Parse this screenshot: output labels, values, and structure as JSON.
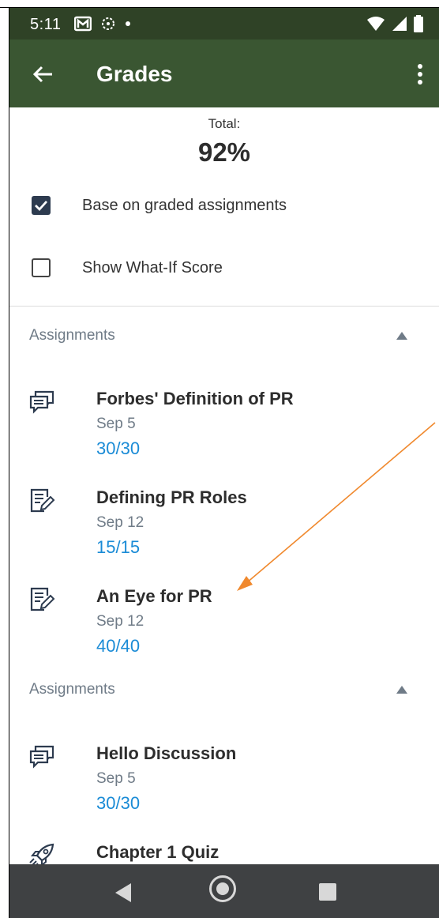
{
  "status_bar": {
    "time": "5:11",
    "icons_left": [
      "mail-icon",
      "app-icon",
      "dot-icon"
    ],
    "icons_right": [
      "wifi-icon",
      "signal-icon",
      "battery-icon"
    ]
  },
  "app_bar": {
    "title": "Grades",
    "back_icon": "arrow-left-icon",
    "menu_icon": "more-vert-icon"
  },
  "total": {
    "label": "Total:",
    "value": "92%"
  },
  "options": {
    "base_on_graded": {
      "label": "Base on graded assignments",
      "checked": true
    },
    "what_if": {
      "label": "Show What-If Score",
      "checked": false
    }
  },
  "sections": [
    {
      "header": "Assignments",
      "items": [
        {
          "title": "Forbes' Definition of PR",
          "date": "Sep 5",
          "score": "30/30",
          "icon": "discussion-icon"
        },
        {
          "title": "Defining PR Roles",
          "date": "Sep 12",
          "score": "15/15",
          "icon": "assignment-icon"
        },
        {
          "title": "An Eye for PR",
          "date": "Sep 12",
          "score": "40/40",
          "icon": "assignment-icon"
        }
      ]
    },
    {
      "header": "Assignments",
      "items": [
        {
          "title": "Hello Discussion",
          "date": "Sep 5",
          "score": "30/30",
          "icon": "discussion-icon"
        },
        {
          "title": "Chapter 1 Quiz",
          "date": "",
          "score": "",
          "icon": "quiz-rocket-icon"
        }
      ]
    }
  ],
  "colors": {
    "app_bar": "#3a5632",
    "status_bar": "#2f4226",
    "score": "#1a8bd6",
    "annotation_arrow": "#f0892e"
  }
}
